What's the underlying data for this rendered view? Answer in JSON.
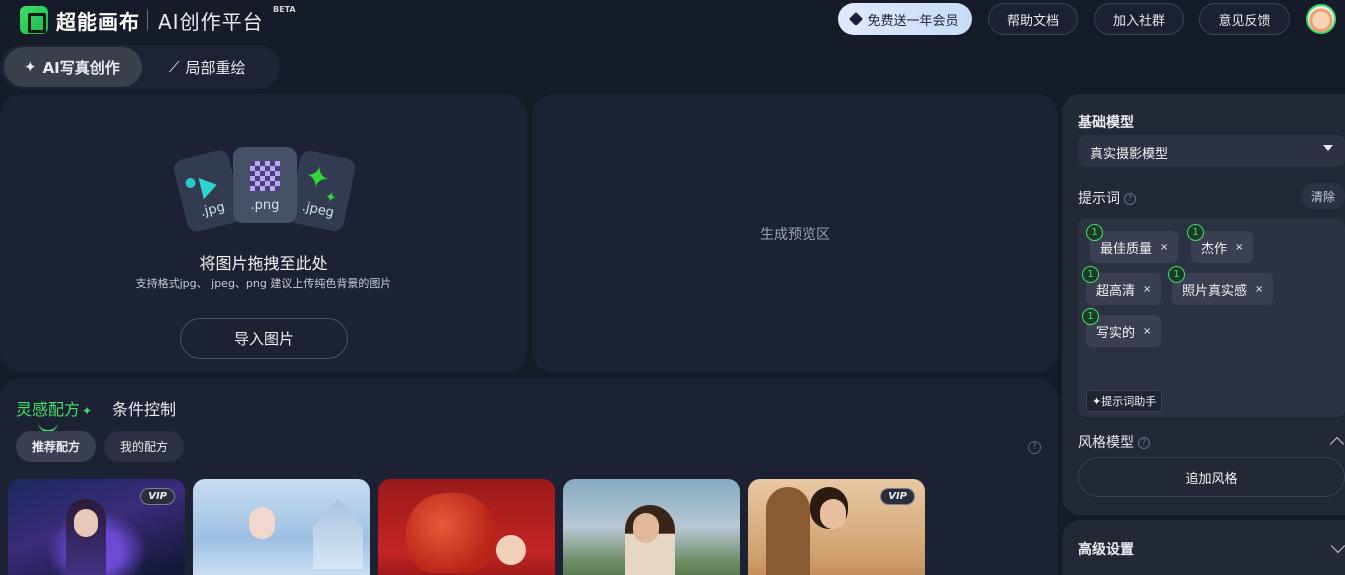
{
  "header": {
    "logo_text": "超能画布",
    "logo_sub": "AI创作平台",
    "beta": "BETA",
    "buttons": {
      "vip": "免费送一年会员",
      "help": "帮助文档",
      "community": "加入社群",
      "feedback": "意见反馈"
    }
  },
  "mode_tabs": {
    "active": "AI写真创作",
    "inactive": "局部重绘"
  },
  "upload": {
    "file_types": [
      ".jpg",
      ".png",
      ".jpeg"
    ],
    "title": "将图片拖拽至此处",
    "hint": "支持格式jpg、 jpeg、png 建议上传纯色背景的图片",
    "import_button": "导入图片"
  },
  "preview": {
    "placeholder": "生成预览区"
  },
  "recipes": {
    "tabs": {
      "active": "灵感配方",
      "inactive": "条件控制"
    },
    "pills": {
      "active": "推荐配方",
      "inactive": "我的配方"
    },
    "help_icon": "?",
    "vip_badge": "VIP"
  },
  "sidebar": {
    "base_model": {
      "label": "基础模型",
      "value": "真实摄影模型"
    },
    "prompt": {
      "label": "提示词",
      "clear": "清除",
      "tags": [
        {
          "text": "最佳质量",
          "weight": "1"
        },
        {
          "text": "杰作",
          "weight": "1"
        },
        {
          "text": "超高清",
          "weight": "1"
        },
        {
          "text": "照片真实感",
          "weight": "1"
        },
        {
          "text": "写实的",
          "weight": "1"
        }
      ],
      "assistant": "提示词助手",
      "close_mark": "×"
    },
    "style_model": {
      "label": "风格模型",
      "add_button": "追加风格"
    },
    "advanced": {
      "label": "高级设置"
    },
    "help_icon": "?"
  },
  "colors": {
    "accent_green": "#3fe06a",
    "background": "#151b28",
    "panel": "#1c2233"
  },
  "icons": [
    "heart-gem-icon",
    "ai-portrait-icon",
    "magic-wand-icon",
    "sparkle-icon",
    "chevron-up-icon",
    "chevron-down-icon",
    "dropdown-arrow-icon",
    "help-icon",
    "close-icon"
  ]
}
